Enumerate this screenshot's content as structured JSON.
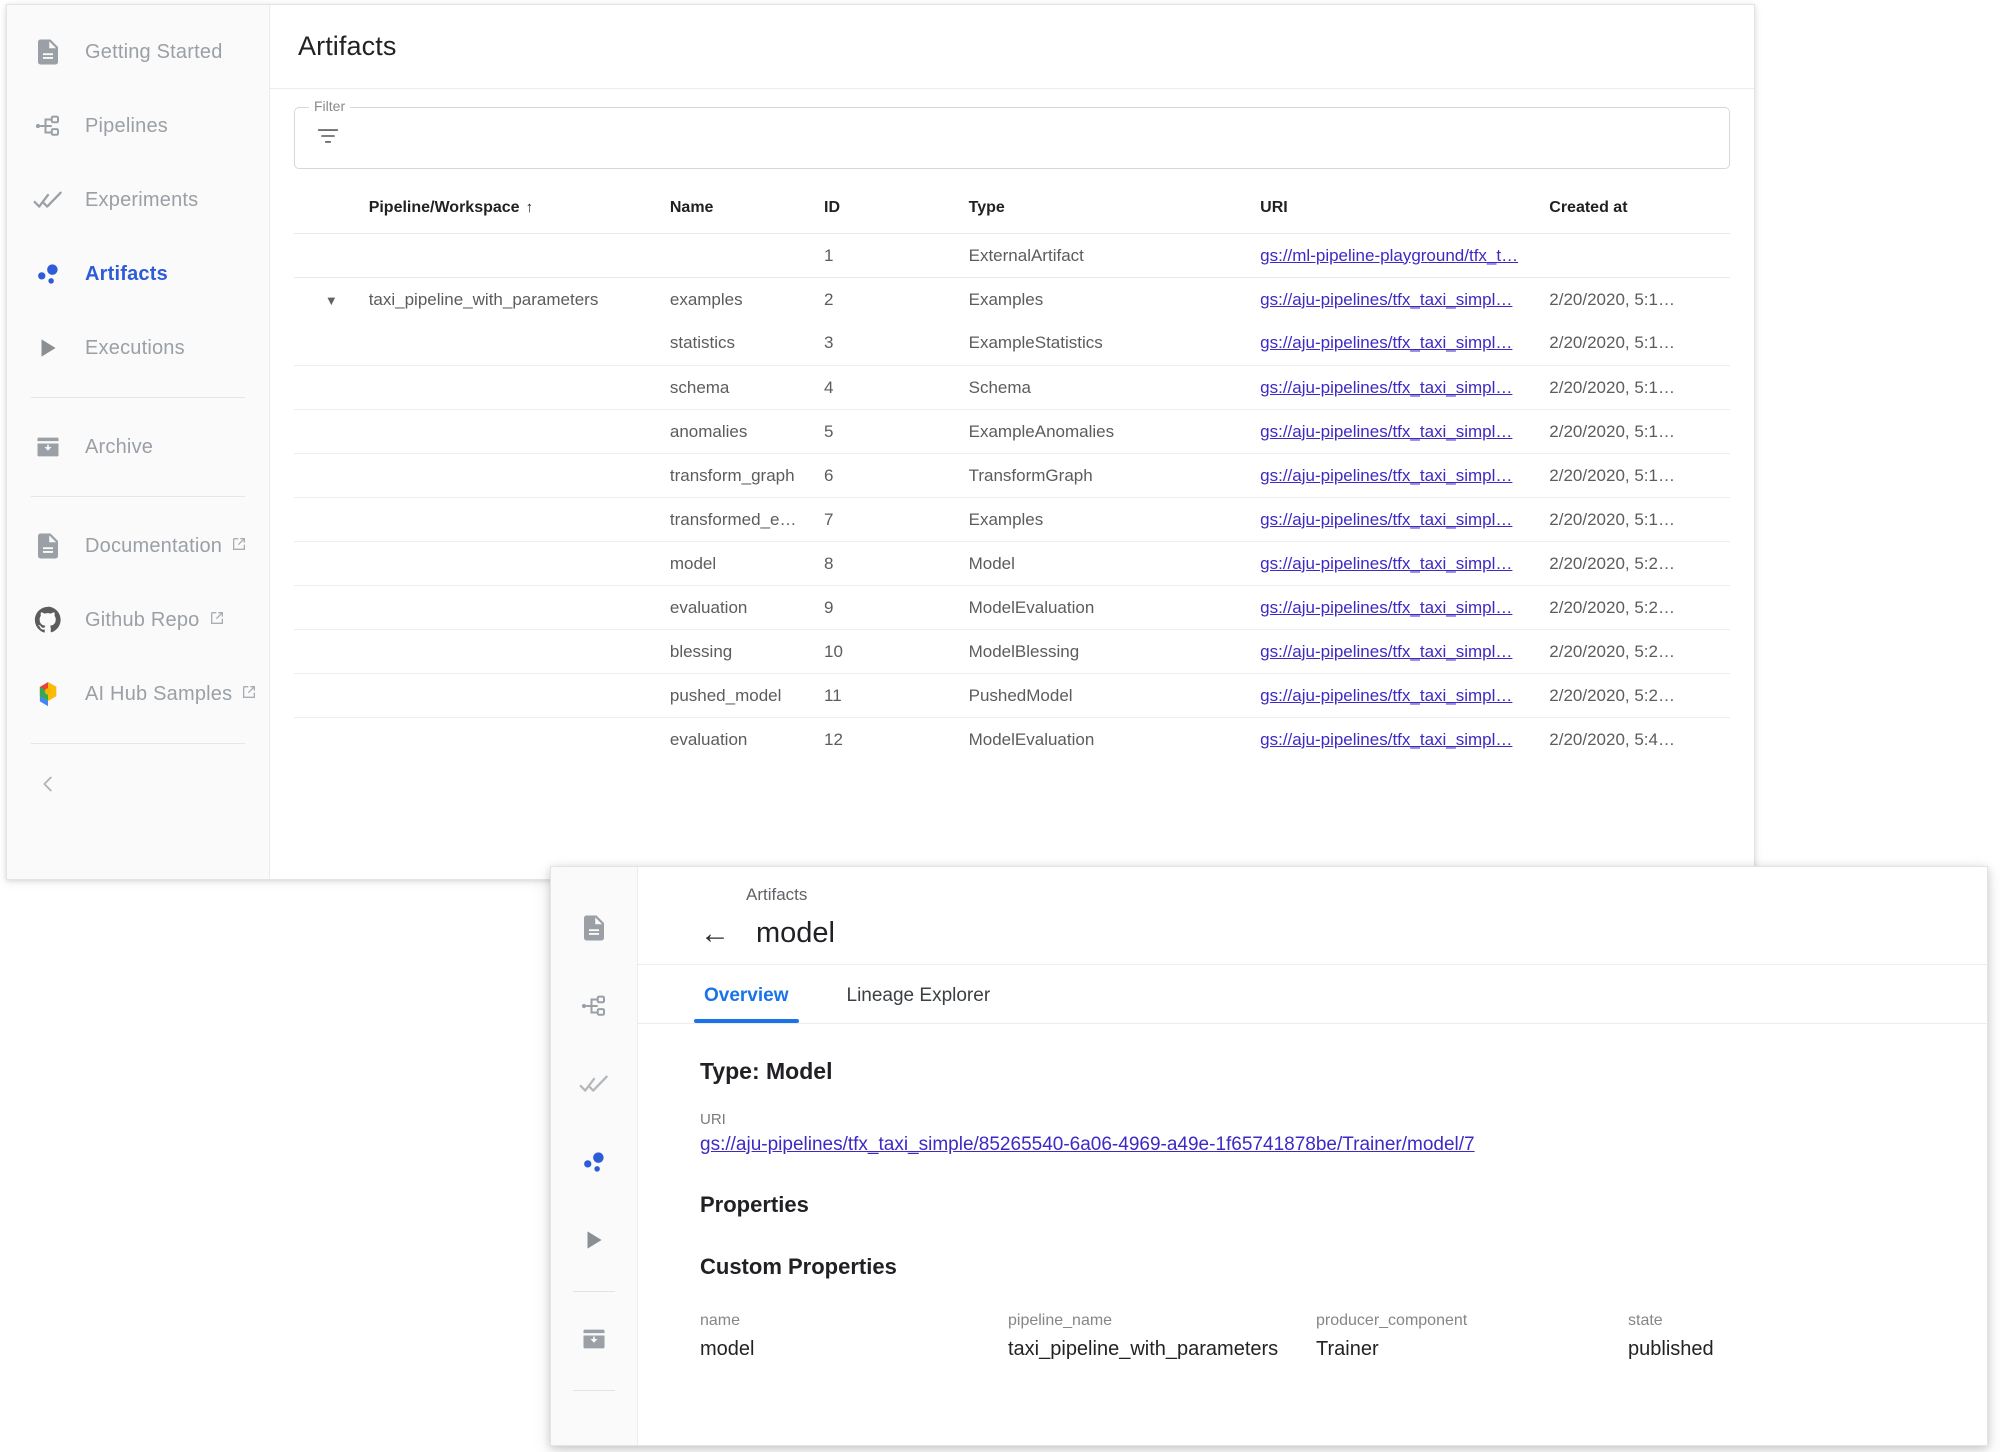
{
  "sidebar": {
    "items": [
      {
        "label": "Getting Started",
        "icon": "document-icon",
        "active": false,
        "external": false
      },
      {
        "label": "Pipelines",
        "icon": "pipeline-icon",
        "active": false,
        "external": false
      },
      {
        "label": "Experiments",
        "icon": "double-check-icon",
        "active": false,
        "external": false
      },
      {
        "label": "Artifacts",
        "icon": "artifacts-icon",
        "active": true,
        "external": false
      },
      {
        "label": "Executions",
        "icon": "play-icon",
        "active": false,
        "external": false
      }
    ],
    "group2": [
      {
        "label": "Archive",
        "icon": "archive-icon",
        "external": false
      }
    ],
    "group3": [
      {
        "label": "Documentation",
        "icon": "document-icon",
        "external": true
      },
      {
        "label": "Github Repo",
        "icon": "github-icon",
        "external": true
      },
      {
        "label": "AI Hub Samples",
        "icon": "aihub-icon",
        "external": true
      }
    ],
    "collapse_icon": "chevron-left-icon",
    "external_icon": "open-in-new-icon"
  },
  "page": {
    "title": "Artifacts"
  },
  "filter": {
    "legend": "Filter",
    "icon": "filter-icon",
    "value": "",
    "placeholder": ""
  },
  "table": {
    "columns": [
      "Pipeline/Workspace",
      "Name",
      "ID",
      "Type",
      "URI",
      "Created at"
    ],
    "sort_column": "Pipeline/Workspace",
    "sort_direction_icon": "arrow-up-icon",
    "expand_icon": "caret-down-icon",
    "ungrouped_rows": [
      {
        "workspace": "",
        "name": "",
        "id": "1",
        "type": "ExternalArtifact",
        "uri": "gs://ml-pipeline-playground/tfx_t…",
        "created_at": ""
      }
    ],
    "group": {
      "workspace": "taxi_pipeline_with_parameters",
      "expanded": true,
      "rows": [
        {
          "name": "examples",
          "id": "2",
          "type": "Examples",
          "uri": "gs://aju-pipelines/tfx_taxi_simpl…",
          "created_at": "2/20/2020, 5:1…"
        },
        {
          "name": "statistics",
          "id": "3",
          "type": "ExampleStatistics",
          "uri": "gs://aju-pipelines/tfx_taxi_simpl…",
          "created_at": "2/20/2020, 5:1…"
        },
        {
          "name": "schema",
          "id": "4",
          "type": "Schema",
          "uri": "gs://aju-pipelines/tfx_taxi_simpl…",
          "created_at": "2/20/2020, 5:1…"
        },
        {
          "name": "anomalies",
          "id": "5",
          "type": "ExampleAnomalies",
          "uri": "gs://aju-pipelines/tfx_taxi_simpl…",
          "created_at": "2/20/2020, 5:1…"
        },
        {
          "name": "transform_graph",
          "id": "6",
          "type": "TransformGraph",
          "uri": "gs://aju-pipelines/tfx_taxi_simpl…",
          "created_at": "2/20/2020, 5:1…"
        },
        {
          "name": "transformed_e…",
          "id": "7",
          "type": "Examples",
          "uri": "gs://aju-pipelines/tfx_taxi_simpl…",
          "created_at": "2/20/2020, 5:1…"
        },
        {
          "name": "model",
          "id": "8",
          "type": "Model",
          "uri": "gs://aju-pipelines/tfx_taxi_simpl…",
          "created_at": "2/20/2020, 5:2…"
        },
        {
          "name": "evaluation",
          "id": "9",
          "type": "ModelEvaluation",
          "uri": "gs://aju-pipelines/tfx_taxi_simpl…",
          "created_at": "2/20/2020, 5:2…"
        },
        {
          "name": "blessing",
          "id": "10",
          "type": "ModelBlessing",
          "uri": "gs://aju-pipelines/tfx_taxi_simpl…",
          "created_at": "2/20/2020, 5:2…"
        },
        {
          "name": "pushed_model",
          "id": "11",
          "type": "PushedModel",
          "uri": "gs://aju-pipelines/tfx_taxi_simpl…",
          "created_at": "2/20/2020, 5:2…"
        },
        {
          "name": "evaluation",
          "id": "12",
          "type": "ModelEvaluation",
          "uri": "gs://aju-pipelines/tfx_taxi_simpl…",
          "created_at": "2/20/2020, 5:4…"
        }
      ]
    }
  },
  "detail": {
    "rail_icons": [
      "document-icon",
      "pipeline-icon",
      "double-check-icon",
      "artifacts-icon",
      "play-icon",
      "archive-icon"
    ],
    "breadcrumb": "Artifacts",
    "back_icon": "arrow-left-icon",
    "title": "model",
    "tabs": [
      {
        "label": "Overview",
        "active": true
      },
      {
        "label": "Lineage Explorer",
        "active": false
      }
    ],
    "type_heading": "Type: Model",
    "uri_label": "URI",
    "uri_value": "gs://aju-pipelines/tfx_taxi_simple/85265540-6a06-4969-a49e-1f65741878be/Trainer/model/7",
    "properties_heading": "Properties",
    "custom_properties_heading": "Custom Properties",
    "custom_properties": [
      {
        "key": "name",
        "value": "model"
      },
      {
        "key": "pipeline_name",
        "value": "taxi_pipeline_with_parameters"
      },
      {
        "key": "producer_component",
        "value": "Trainer"
      },
      {
        "key": "state",
        "value": "published"
      }
    ]
  },
  "colors": {
    "accent": "#1a73e8",
    "sidebar_active": "#2e5bd8",
    "link": "#3d29c4",
    "muted_text": "#9aa0a6"
  }
}
